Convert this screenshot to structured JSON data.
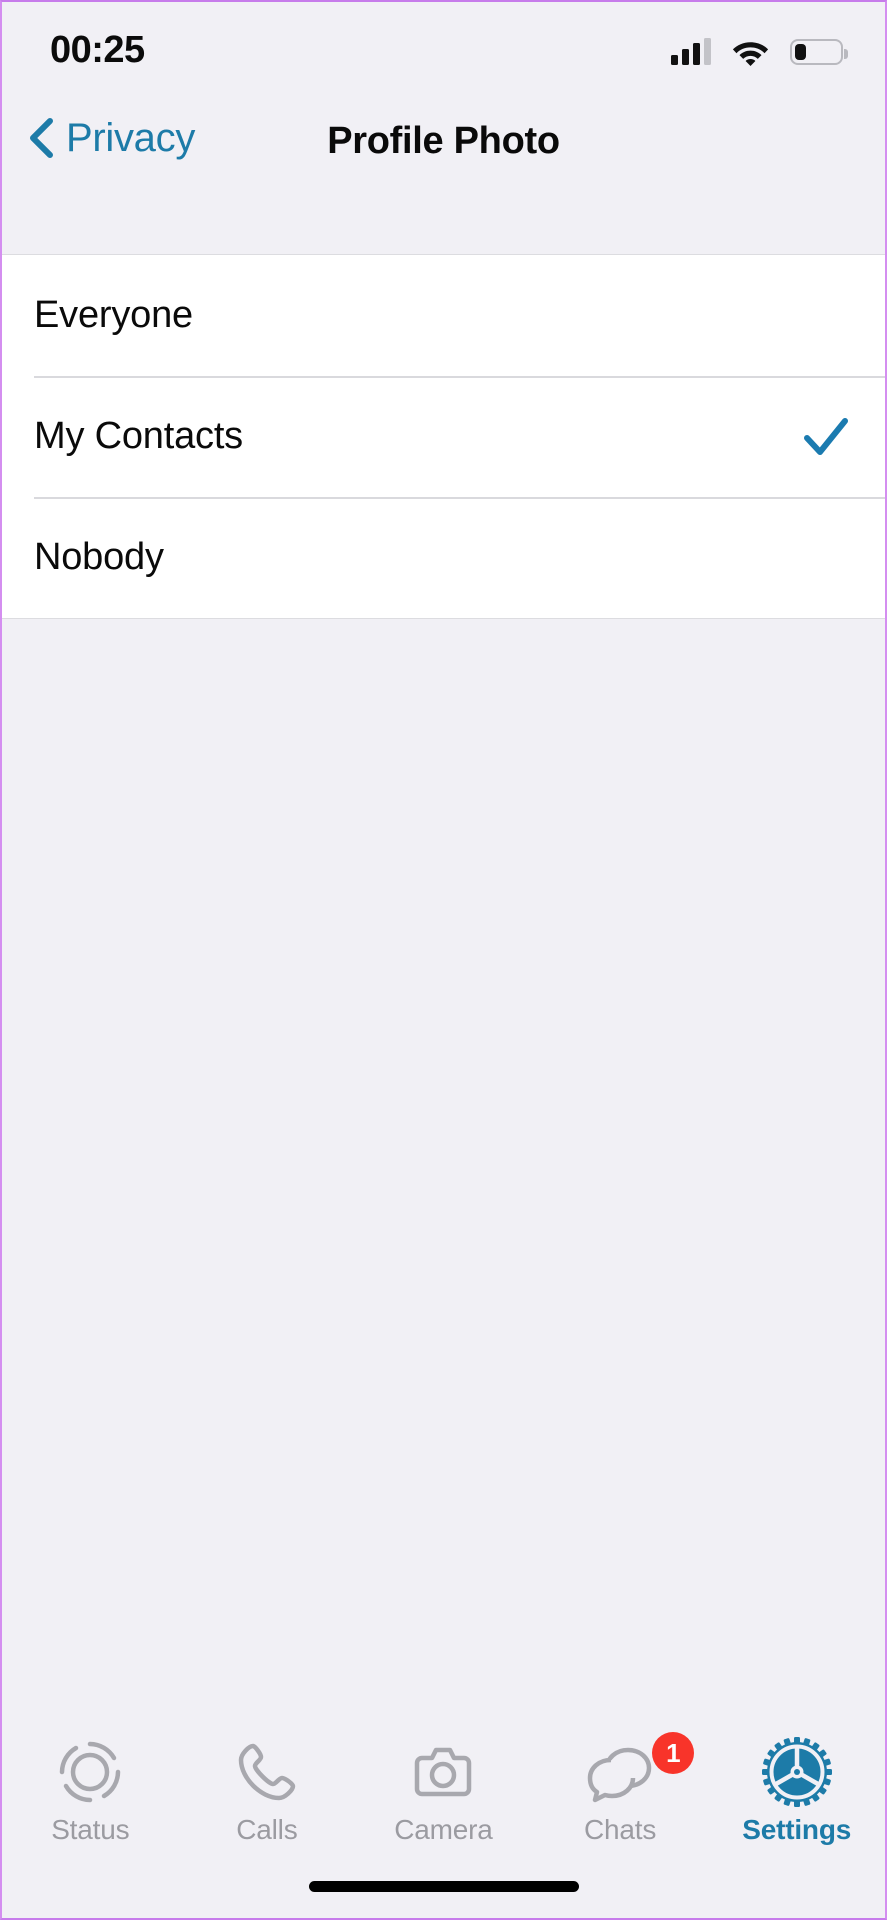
{
  "status_bar": {
    "time": "00:25",
    "signal_icon": "cellular-signal-icon",
    "wifi_icon": "wifi-icon",
    "battery_icon": "battery-icon",
    "battery_level_percent": 25
  },
  "nav_bar": {
    "back_label": "Privacy",
    "back_icon": "chevron-left-icon",
    "title": "Profile Photo",
    "accent_color": "#1d7ba8"
  },
  "options": [
    {
      "label": "Everyone",
      "selected": false
    },
    {
      "label": "My Contacts",
      "selected": true
    },
    {
      "label": "Nobody",
      "selected": false
    }
  ],
  "selected_option": "My Contacts",
  "check_icon": "checkmark-icon",
  "tabs": [
    {
      "label": "Status",
      "icon": "status-ring-icon",
      "active": false,
      "badge": null
    },
    {
      "label": "Calls",
      "icon": "phone-icon",
      "active": false,
      "badge": null
    },
    {
      "label": "Camera",
      "icon": "camera-icon",
      "active": false,
      "badge": null
    },
    {
      "label": "Chats",
      "icon": "chat-bubbles-icon",
      "active": false,
      "badge": "1"
    },
    {
      "label": "Settings",
      "icon": "gear-icon",
      "active": true,
      "badge": null
    }
  ],
  "colors": {
    "background": "#f1f0f5",
    "surface": "#ffffff",
    "accent": "#1d7ba8",
    "inactive": "#9b9ba1",
    "badge": "#f8342a",
    "frame": "#d48ef0"
  },
  "home_indicator": "home-indicator"
}
